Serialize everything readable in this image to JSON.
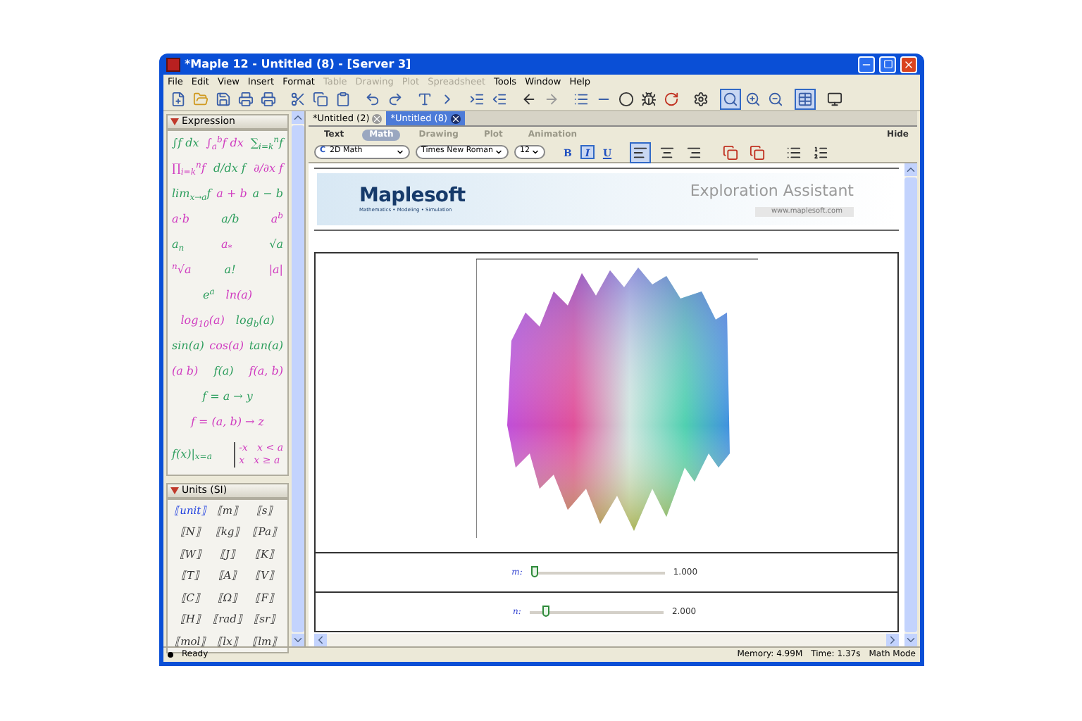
{
  "window": {
    "title": "*Maple 12 - Untitled (8) - [Server 3]"
  },
  "menu": [
    {
      "label": "File",
      "disabled": false
    },
    {
      "label": "Edit",
      "disabled": false
    },
    {
      "label": "View",
      "disabled": false
    },
    {
      "label": "Insert",
      "disabled": false
    },
    {
      "label": "Format",
      "disabled": false
    },
    {
      "label": "Table",
      "disabled": true
    },
    {
      "label": "Drawing",
      "disabled": true
    },
    {
      "label": "Plot",
      "disabled": true
    },
    {
      "label": "Spreadsheet",
      "disabled": true
    },
    {
      "label": "Tools",
      "disabled": false
    },
    {
      "label": "Window",
      "disabled": false
    },
    {
      "label": "Help",
      "disabled": false
    }
  ],
  "toolbar": {
    "zoom_buttons": [
      {
        "selected": true
      },
      {
        "selected": false
      },
      {
        "selected": false
      }
    ],
    "toggle_selected": true
  },
  "palettes": {
    "expression": {
      "title": "Expression",
      "expanded": true,
      "rows": [
        [
          "∫f dx",
          "∫$_{a}$$^{b}$f dx",
          "∑$_{i=k}$$^{n}$f"
        ],
        [
          "∏$_{i=k}$$^{n}$f",
          "d/dx f",
          "∂/∂x f"
        ],
        [
          "lim$_{x→a}$f",
          "a + b",
          "a − b"
        ],
        [
          "a·b",
          "a/b",
          "a$^{b}$"
        ],
        [
          "a$_{n}$",
          "a$_{*}$",
          "√a"
        ],
        [
          "$^{n}$√a",
          "a!",
          "|a|"
        ],
        [
          "e$^{a}$",
          "ln(a)"
        ],
        [
          "log$_{10}$(a)",
          "log$_{b}$(a)"
        ],
        [
          "sin(a)",
          "cos(a)",
          "tan(a)"
        ],
        [
          "(a b)",
          "f(a)",
          "f(a, b)"
        ],
        [
          "f = a → y"
        ],
        [
          "f = (a, b) → z"
        ]
      ],
      "last_row": {
        "eval": "f(x)|$_{x=a}$",
        "piecewise": [
          "-x   x < a",
          "x   x ≥ a"
        ]
      }
    },
    "units": {
      "title": "Units (SI)",
      "expanded": true,
      "rows": [
        [
          "⟦unit⟧",
          "⟦m⟧",
          "⟦s⟧"
        ],
        [
          "⟦N⟧",
          "⟦kg⟧",
          "⟦Pa⟧"
        ],
        [
          "⟦W⟧",
          "⟦J⟧",
          "⟦K⟧"
        ],
        [
          "⟦T⟧",
          "⟦A⟧",
          "⟦V⟧"
        ],
        [
          "⟦C⟧",
          "⟦Ω⟧",
          "⟦F⟧"
        ],
        [
          "⟦H⟧",
          "⟦rad⟧",
          "⟦sr⟧"
        ],
        [
          "⟦mol⟧",
          "⟦lx⟧",
          "⟦lm⟧"
        ]
      ]
    }
  },
  "doc_tabs": [
    {
      "label": "*Untitled (2)",
      "selected": false
    },
    {
      "label": "*Untitled (8)",
      "selected": true
    }
  ],
  "mode_tabs": [
    {
      "label": "Text",
      "selected": false,
      "disabled": false
    },
    {
      "label": "Math",
      "selected": true,
      "disabled": false
    },
    {
      "label": "Drawing",
      "selected": false,
      "disabled": true
    },
    {
      "label": "Plot",
      "selected": false,
      "disabled": true
    },
    {
      "label": "Animation",
      "selected": false,
      "disabled": true
    }
  ],
  "hide_label": "Hide",
  "format_bar": {
    "mode": "2D Math",
    "mode_icon": "C",
    "font": "Times New Roman",
    "size": "12",
    "styles": [
      {
        "label": "B",
        "selected": false
      },
      {
        "label": "I",
        "selected": true
      },
      {
        "label": "U",
        "selected": false
      }
    ],
    "align": [
      {
        "selected": true
      },
      {
        "selected": false
      },
      {
        "selected": false
      }
    ]
  },
  "banner": {
    "logo": "Maplesoft",
    "tagline": "Mathematics • Modeling • Simulation",
    "title": "Exploration Assistant",
    "url": "www.maplesoft.com"
  },
  "sliders": [
    {
      "name": "m:",
      "level": 0.0,
      "reading": "1.000"
    },
    {
      "name": "n:",
      "level": 0.1,
      "reading": "2.000"
    }
  ],
  "status_bar": {
    "state": "Ready",
    "memory": "Memory: 4.99M",
    "time": "Time: 1.37s",
    "mode": "Math Mode"
  }
}
